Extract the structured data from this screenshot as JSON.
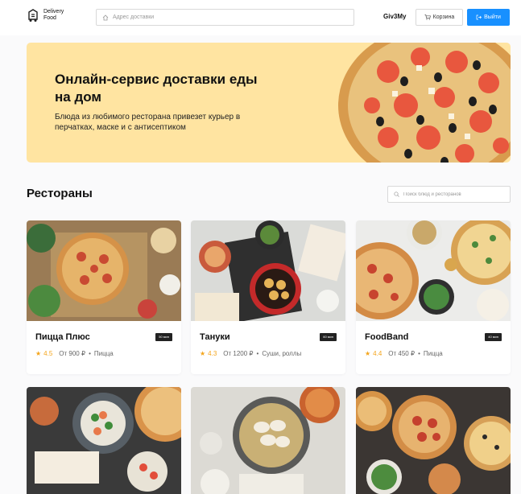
{
  "header": {
    "logo_line1": "Delivery",
    "logo_line2": "Food",
    "address_placeholder": "Адрес доставки",
    "user_name": "Giv3My",
    "cart_label": "Корзина",
    "logout_label": "Выйти"
  },
  "promo": {
    "title": "Онлайн-сервис доставки еды на дом",
    "text": "Блюда из любимого ресторана привезет курьер в перчатках, маске и с антисептиком"
  },
  "restaurants": {
    "title": "Рестораны",
    "search_placeholder": "Поиск блюд и ресторанов",
    "items": [
      {
        "name": "Пицца Плюс",
        "time": "50 мин",
        "rating": "4.5",
        "price": "От 900 ₽",
        "category": "Пицца"
      },
      {
        "name": "Тануки",
        "time": "60 мин",
        "rating": "4.3",
        "price": "От 1200 ₽",
        "category": "Суши, роллы"
      },
      {
        "name": "FoodBand",
        "time": "40 мин",
        "rating": "4.4",
        "price": "От 450 ₽",
        "category": "Пицца"
      }
    ]
  },
  "colors": {
    "accent": "#1890ff",
    "promo_bg": "#ffe4a1",
    "rating": "#f4a51c"
  }
}
